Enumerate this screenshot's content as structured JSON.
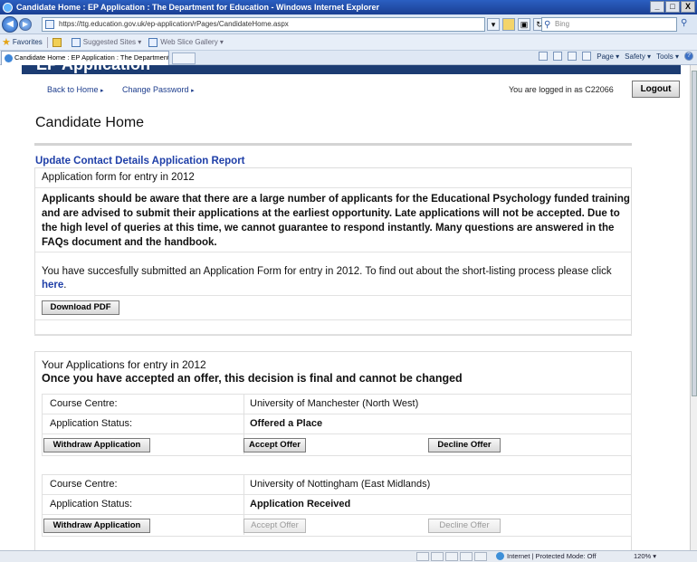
{
  "browser": {
    "title": "Candidate Home : EP Application : The Department for Education - Windows Internet Explorer",
    "url": "https://ttg.education.gov.uk/ep-application/rPages/CandidateHome.aspx",
    "search_placeholder": "Bing",
    "favorites_label": "Favorites",
    "favorites_items": [
      "Suggested Sites ▾",
      "Web Slice Gallery ▾"
    ],
    "tab_label": "Candidate Home : EP Application : The Department fo...",
    "commands": [
      "Page ▾",
      "Safety ▾",
      "Tools ▾"
    ],
    "status_zone": "Internet | Protected Mode: Off",
    "zoom": "120% ▾",
    "win_buttons": [
      "_",
      "□",
      "X"
    ]
  },
  "site": {
    "banner_text": "EP Application",
    "nav": {
      "back_home": "Back to Home",
      "change_password": "Change Password",
      "arrow": "▸"
    },
    "logged_in_text": "You are logged in as C22066",
    "logout_label": "Logout"
  },
  "page": {
    "title": "Candidate Home",
    "report_links": "Update Contact Details Application Report",
    "form_heading": "Application form for entry in 2012",
    "notice": "Applicants should be aware that there are a large number of applicants for the Educational Psychology funded training and are advised to submit their applications at the earliest opportunity. Late applications will not be accepted. Due to the high level of queries at this time, we cannot guarantee to respond instantly. Many questions are answered in the FAQs document and the handbook.",
    "submitted_text": "You have succesfully submitted an Application Form for entry in 2012. To find out about the short-listing process please click",
    "here_link": "here",
    "period": ".",
    "download_pdf": "Download PDF",
    "applications_heading": "Your Applications for entry in 2012",
    "applications_warning": "Once you have accepted an offer, this decision is final and cannot be changed"
  },
  "applications": [
    {
      "centre_label": "Course Centre:",
      "centre_value": "University of Manchester (North West)",
      "status_label": "Application Status:",
      "status_value": "Offered a Place",
      "withdraw": "Withdraw Application",
      "accept": "Accept Offer",
      "decline": "Decline Offer",
      "accept_enabled": true,
      "decline_enabled": true
    },
    {
      "centre_label": "Course Centre:",
      "centre_value": "University of Nottingham (East Midlands)",
      "status_label": "Application Status:",
      "status_value": "Application Received",
      "withdraw": "Withdraw Application",
      "accept": "Accept Offer",
      "decline": "Decline Offer",
      "accept_enabled": false,
      "decline_enabled": false
    }
  ]
}
